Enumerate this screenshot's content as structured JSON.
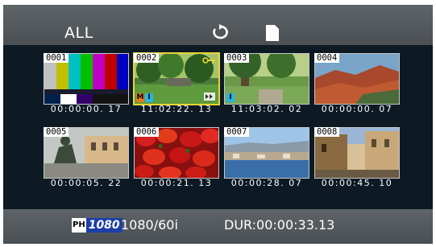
{
  "header": {
    "title": "ALL",
    "icons": [
      "repeat-icon",
      "sd-card-icon"
    ]
  },
  "clips": [
    {
      "number": "0001",
      "timecode": "00:00:00. 17",
      "selected": false,
      "scene": "color-bars",
      "badges": []
    },
    {
      "number": "0002",
      "timecode": "11:02:22. 13",
      "selected": true,
      "scene": "park-trees",
      "badges": [
        "M",
        "I"
      ],
      "indicators": [
        "key-icon",
        "fast-forward-icon"
      ]
    },
    {
      "number": "0003",
      "timecode": "11:03:02. 02",
      "selected": false,
      "scene": "park-path",
      "badges": [
        "I"
      ]
    },
    {
      "number": "0004",
      "timecode": "00:00:00. 07",
      "selected": false,
      "scene": "red-rocks",
      "badges": []
    },
    {
      "number": "0005",
      "timecode": "00:00:05. 22",
      "selected": false,
      "scene": "statue-building",
      "badges": []
    },
    {
      "number": "0006",
      "timecode": "00:00:21. 13",
      "selected": false,
      "scene": "red-peppers",
      "badges": []
    },
    {
      "number": "0007",
      "timecode": "00:00:28. 07",
      "selected": false,
      "scene": "harbor-town",
      "badges": []
    },
    {
      "number": "0008",
      "timecode": "00:00:45. 10",
      "selected": false,
      "scene": "old-street",
      "badges": []
    }
  ],
  "footer": {
    "badge_ph": "PH",
    "badge_res": "1080",
    "format": "1080/60i",
    "duration": "DUR:00:00:33.13"
  },
  "colors": {
    "selection": "#e8d53a",
    "badge_m": "#e87a1c",
    "badge_i": "#28b4e0",
    "res_badge": "#1d3fa8"
  }
}
